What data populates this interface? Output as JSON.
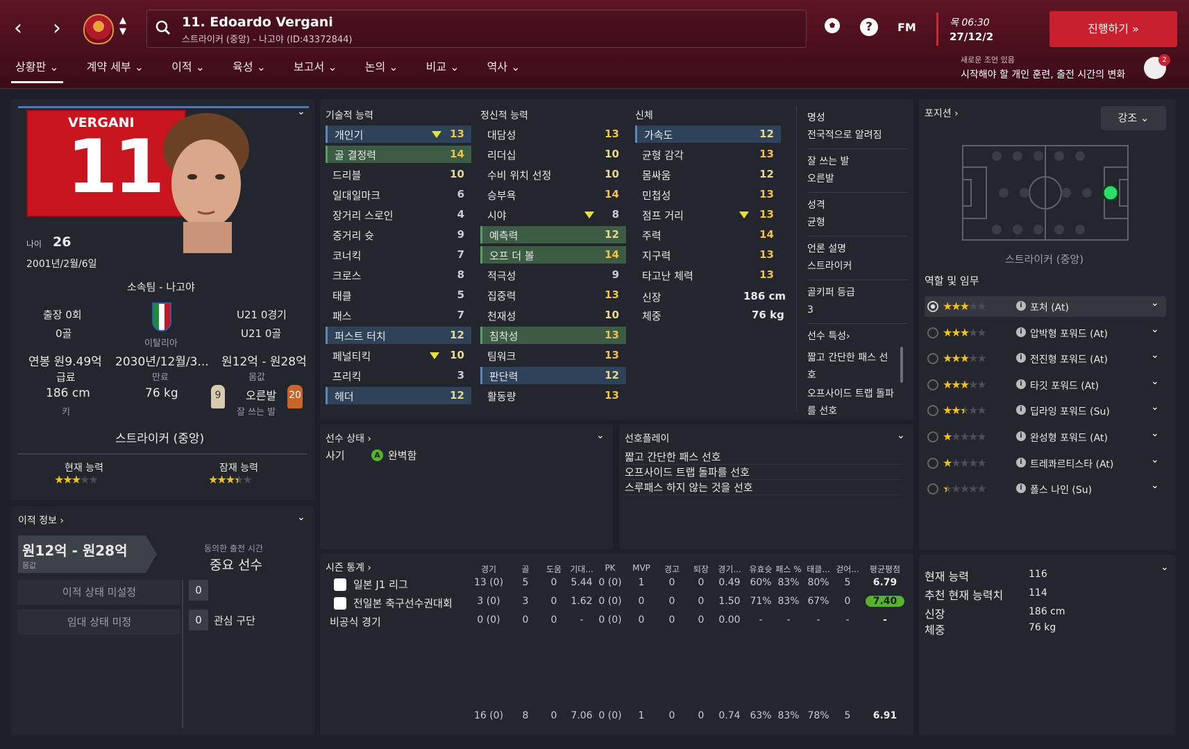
{
  "header": {
    "player_title": "11. Edoardo Vergani",
    "player_sub": "스트라이커 (중앙) - 나고야 (ID:43372844)",
    "fm_label": "FM",
    "day_time": "목 06:30",
    "date": "27/12/2",
    "continue_label": "진행하기 »",
    "notice_title": "새로운 조언 있음",
    "notice_text": "시작해야 할 개인 훈련, 출전 시간의 변화",
    "notice_count": "2"
  },
  "tabs": [
    "상황판",
    "계약 세부",
    "이적",
    "육성",
    "보고서",
    "논의",
    "비교",
    "역사"
  ],
  "profile": {
    "shirt_name": "VERGANI",
    "shirt_number": "11",
    "age_label": "나이",
    "age": "26",
    "dob": "2001년/2월/6일",
    "club": "소속팀 - 나고야",
    "apps": "출장 0회",
    "goals": "0골",
    "nation": "이탈리아",
    "u21_apps": "U21 0경기",
    "u21_goals": "U21 0골",
    "wage": "연봉 원9.49억",
    "wage_label": "급료",
    "expiry": "2030년/12월/3...",
    "expiry_label": "만료",
    "value": "원12억 - 원28억",
    "value_label": "몸값",
    "height": "186 cm",
    "height_label": "키",
    "weight": "76 kg",
    "foot_left": "9",
    "foot": "오른발",
    "foot_label": "잘 쓰는 발",
    "foot_right": "20",
    "position": "스트라이커 (중앙)",
    "ca_label": "현재 능력",
    "pa_label": "잠재 능력",
    "ca_stars": 3,
    "pa_stars": 3.5
  },
  "transfer": {
    "header": "이적 정보 ›",
    "value": "원12억 - 원28억",
    "value_label": "몸값",
    "playtime_label": "동의한 출전 시간",
    "playtime": "중요 선수",
    "status": "이적 상태 미설정",
    "loan": "임대 상태 미정",
    "count1": "0",
    "count2": "0",
    "interest": "관심 구단"
  },
  "technical": {
    "title": "기술적 능력",
    "rows": [
      [
        "개인기",
        "13"
      ],
      [
        "골 결정력",
        "14"
      ],
      [
        "드리블",
        "10"
      ],
      [
        "일대일마크",
        "6"
      ],
      [
        "장거리 스로인",
        "4"
      ],
      [
        "중거리 슛",
        "9"
      ],
      [
        "코너킥",
        "7"
      ],
      [
        "크로스",
        "8"
      ],
      [
        "태클",
        "5"
      ],
      [
        "패스",
        "7"
      ],
      [
        "퍼스트 터치",
        "12"
      ],
      [
        "페널티킥",
        "10"
      ],
      [
        "프리킥",
        "3"
      ],
      [
        "헤더",
        "12"
      ]
    ]
  },
  "mental": {
    "title": "정신적 능력",
    "rows": [
      [
        "대담성",
        "13"
      ],
      [
        "리더십",
        "10"
      ],
      [
        "수비 위치 선정",
        "10"
      ],
      [
        "승부욕",
        "14"
      ],
      [
        "시야",
        "8"
      ],
      [
        "예측력",
        "12"
      ],
      [
        "오프 더 볼",
        "14"
      ],
      [
        "적극성",
        "9"
      ],
      [
        "집중력",
        "13"
      ],
      [
        "천재성",
        "10"
      ],
      [
        "침착성",
        "13"
      ],
      [
        "팀워크",
        "13"
      ],
      [
        "판단력",
        "12"
      ],
      [
        "활동량",
        "13"
      ]
    ]
  },
  "physical": {
    "title": "신체",
    "rows": [
      [
        "가속도",
        "12"
      ],
      [
        "균형 감각",
        "13"
      ],
      [
        "몸싸움",
        "12"
      ],
      [
        "민첩성",
        "13"
      ],
      [
        "점프 거리",
        "13"
      ],
      [
        "주력",
        "14"
      ],
      [
        "지구력",
        "13"
      ],
      [
        "타고난 체력",
        "13"
      ]
    ],
    "height_label": "신장",
    "height": "186 cm",
    "weight_label": "체중",
    "weight": "76 kg"
  },
  "info": {
    "rep_label": "명성",
    "rep": "전국적으로 알려짐",
    "foot_label": "잘 쓰는 발",
    "foot": "오른발",
    "pers_label": "성격",
    "pers": "균형",
    "media_label": "언론 설명",
    "media": "스트라이커",
    "gk_label": "골키퍼 등급",
    "gk": "3",
    "traits_label": "선수 특성›",
    "trait1": "짧고 간단한 패스 선호",
    "trait2": "오프사이드 트랩 돌파를 선호"
  },
  "positions": {
    "header": "포지션 ›",
    "highlight": "강조",
    "pos_name": "스트라이커 (중앙)",
    "roles_header": "역할 및 임무",
    "roles": [
      {
        "name": "포처 (At)",
        "stars": 3
      },
      {
        "name": "압박형 포워드 (At)",
        "stars": 3
      },
      {
        "name": "전진형 포워드 (At)",
        "stars": 3
      },
      {
        "name": "타깃 포워드 (At)",
        "stars": 3
      },
      {
        "name": "딥라잉 포워드 (Su)",
        "stars": 2.5
      },
      {
        "name": "완성형 포워드 (At)",
        "stars": 1
      },
      {
        "name": "트레콰르티스타 (At)",
        "stars": 1
      },
      {
        "name": "폴스 나인 (Su)",
        "stars": 0.5
      }
    ]
  },
  "status": {
    "header": "선수 상태 ›",
    "morale_label": "사기",
    "morale": "완벽함"
  },
  "preferred": {
    "header": "선호플레이",
    "items": [
      "짧고 간단한 패스 선호",
      "오프사이드 트랩 돌파를 선호",
      "스루패스 하지 않는 것을 선호"
    ]
  },
  "season": {
    "header": "시즌 통계 ›",
    "cols": [
      "경기",
      "골",
      "도움",
      "기대...",
      "PK",
      "MVP",
      "경고",
      "퇴장",
      "경기...",
      "유효슛",
      "패스 %",
      "태클...",
      "걷어...",
      "평균평점"
    ],
    "rows": [
      {
        "comp": "일본 J1 리그",
        "v": [
          "13 (0)",
          "5",
          "0",
          "5.44",
          "0 (0)",
          "1",
          "0",
          "0",
          "0.49",
          "60%",
          "83%",
          "80%",
          "5",
          "6.79"
        ]
      },
      {
        "comp": "전일본 축구선수권대회",
        "v": [
          "3 (0)",
          "3",
          "0",
          "1.62",
          "0 (0)",
          "0",
          "0",
          "0",
          "1.50",
          "71%",
          "83%",
          "67%",
          "0",
          "7.40"
        ]
      },
      {
        "comp": "비공식 경기",
        "v": [
          "0 (0)",
          "0",
          "0",
          "-",
          "0 (0)",
          "0",
          "0",
          "0",
          "0.00",
          "-",
          "-",
          "-",
          "-",
          "-"
        ]
      }
    ],
    "total": [
      "16 (0)",
      "8",
      "0",
      "7.06",
      "0 (0)",
      "1",
      "0",
      "0",
      "0.74",
      "63%",
      "83%",
      "78%",
      "5",
      "6.91"
    ]
  },
  "summary": {
    "ca_label": "현재 능력",
    "ca": "116",
    "rec_label": "추천 현재 능력치",
    "rec": "114",
    "h_label": "신장",
    "h": "186 cm",
    "w_label": "체중",
    "w": "76 kg"
  },
  "colors": {
    "accent": "#c8202f",
    "header_bg": "#5e1424",
    "panel": "#23262d",
    "green": "#55b32e"
  }
}
